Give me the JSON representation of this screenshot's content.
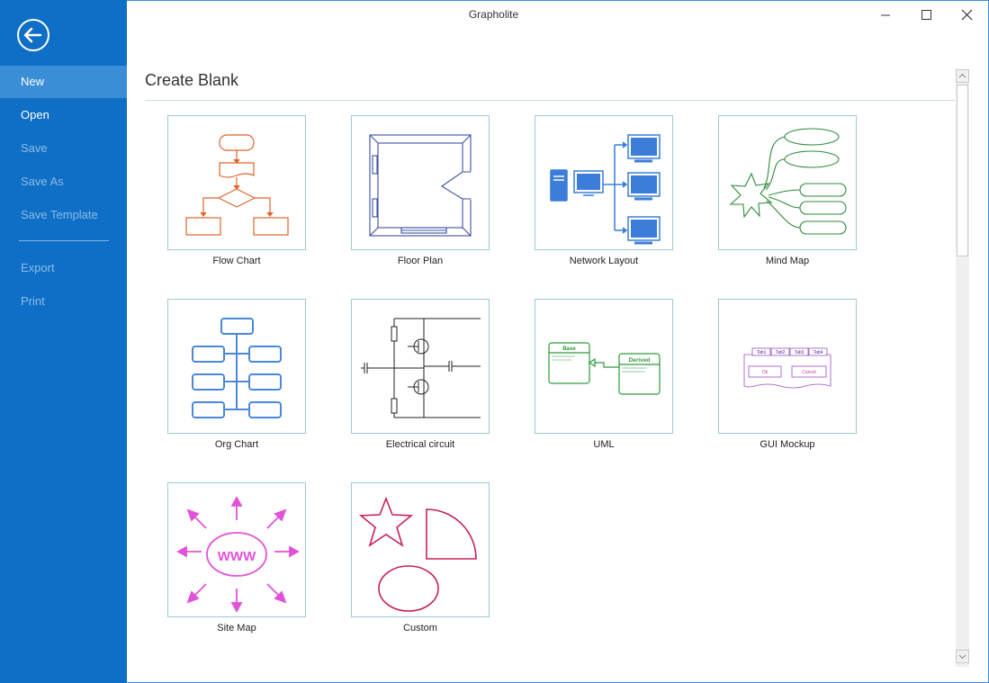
{
  "window": {
    "title": "Grapholite"
  },
  "sidebar": {
    "items": [
      {
        "label": "New",
        "state": "selected"
      },
      {
        "label": "Open",
        "state": "enabled"
      },
      {
        "label": "Save",
        "state": "disabled"
      },
      {
        "label": "Save As",
        "state": "disabled"
      },
      {
        "label": "Save Template",
        "state": "disabled"
      },
      {
        "label": "Export",
        "state": "disabled"
      },
      {
        "label": "Print",
        "state": "disabled"
      }
    ]
  },
  "main": {
    "section_title": "Create Blank",
    "templates": [
      {
        "label": "Flow Chart"
      },
      {
        "label": "Floor Plan"
      },
      {
        "label": "Network Layout"
      },
      {
        "label": "Mind Map"
      },
      {
        "label": "Org Chart"
      },
      {
        "label": "Electrical circuit"
      },
      {
        "label": "UML"
      },
      {
        "label": "GUI Mockup"
      },
      {
        "label": "Site Map"
      },
      {
        "label": "Custom"
      }
    ],
    "uml": {
      "base": "Base",
      "derived": "Derived"
    },
    "gui": {
      "tab1": "Tab1",
      "tab2": "Tab2",
      "tab3": "Tab3",
      "tab4": "Tab4",
      "ok": "Ok",
      "cancel": "Cancel"
    },
    "sitemap": {
      "center": "WWW"
    }
  },
  "colors": {
    "sidebar_bg": "#0f6fc6",
    "flow": "#e0642a",
    "floor": "#3d4f9e",
    "network": "#3b7dd8",
    "mindmap": "#2e8b3a",
    "org": "#4a88d8",
    "uml": "#2e9a3a",
    "gui": "#9b4fc8",
    "sitemap": "#e252d8",
    "custom": "#c8205a"
  }
}
